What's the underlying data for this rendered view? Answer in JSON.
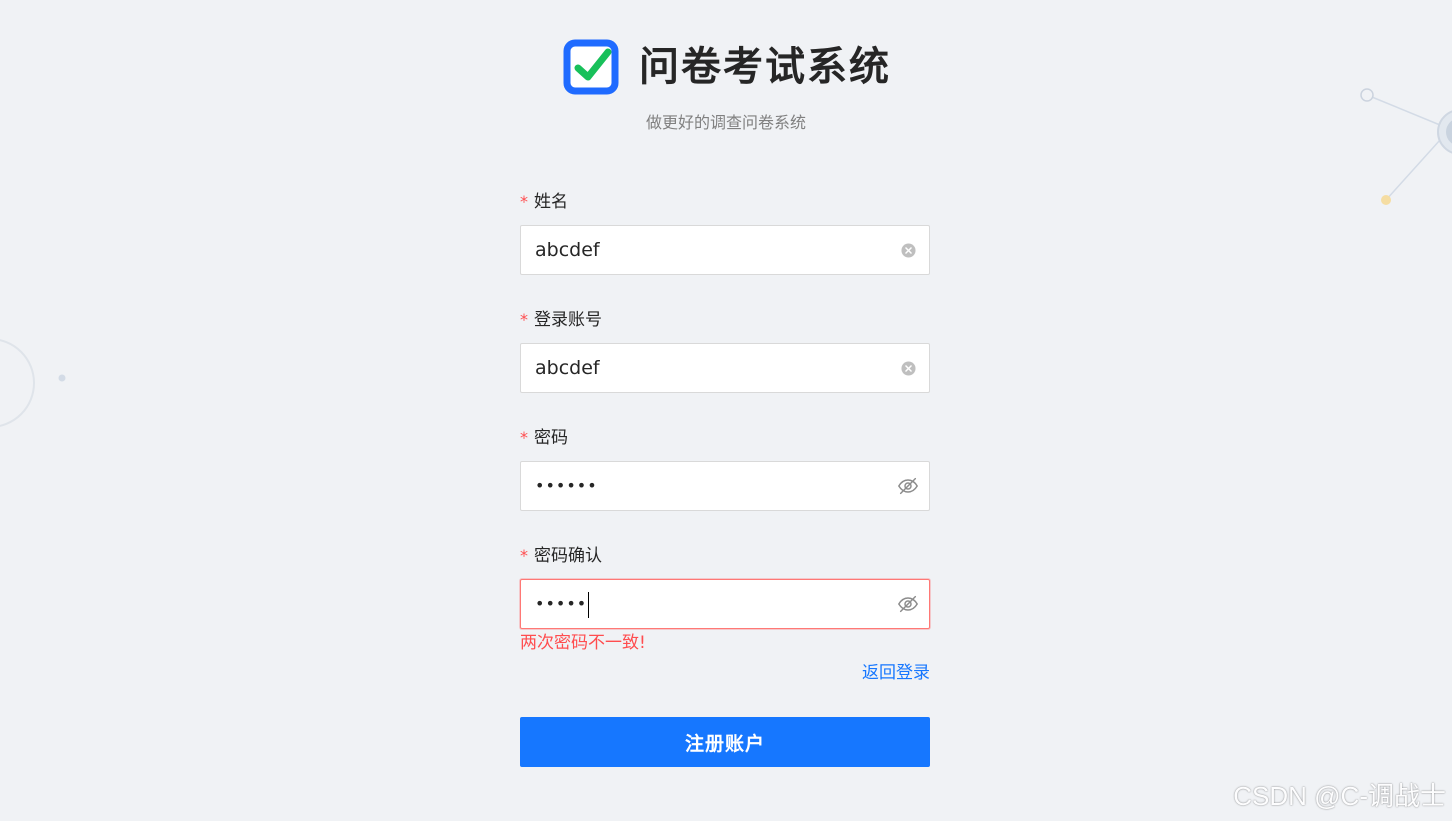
{
  "app": {
    "title": "问卷考试系统",
    "subtitle": "做更好的调查问卷系统"
  },
  "colors": {
    "background": "#f0f2f5",
    "primary": "#1677ff",
    "error": "#ff4d4f",
    "logo_blue": "#1f6bff",
    "logo_check": "#18c05a"
  },
  "form": {
    "required_mark": "*",
    "fields": [
      {
        "label": "姓名",
        "value": "abcdef",
        "suffix_icon": "clear-circle-icon"
      },
      {
        "label": "登录账号",
        "value": "abcdef",
        "suffix_icon": "clear-circle-icon"
      },
      {
        "label": "密码",
        "value": "••••••",
        "suffix_icon": "eye-invisible-icon"
      },
      {
        "label": "密码确认",
        "value": "•••••",
        "suffix_icon": "eye-invisible-icon"
      }
    ],
    "error_message": "两次密码不一致!",
    "back_to_login": "返回登录",
    "submit_label": "注册账户"
  },
  "watermark": "CSDN @C-调战士"
}
